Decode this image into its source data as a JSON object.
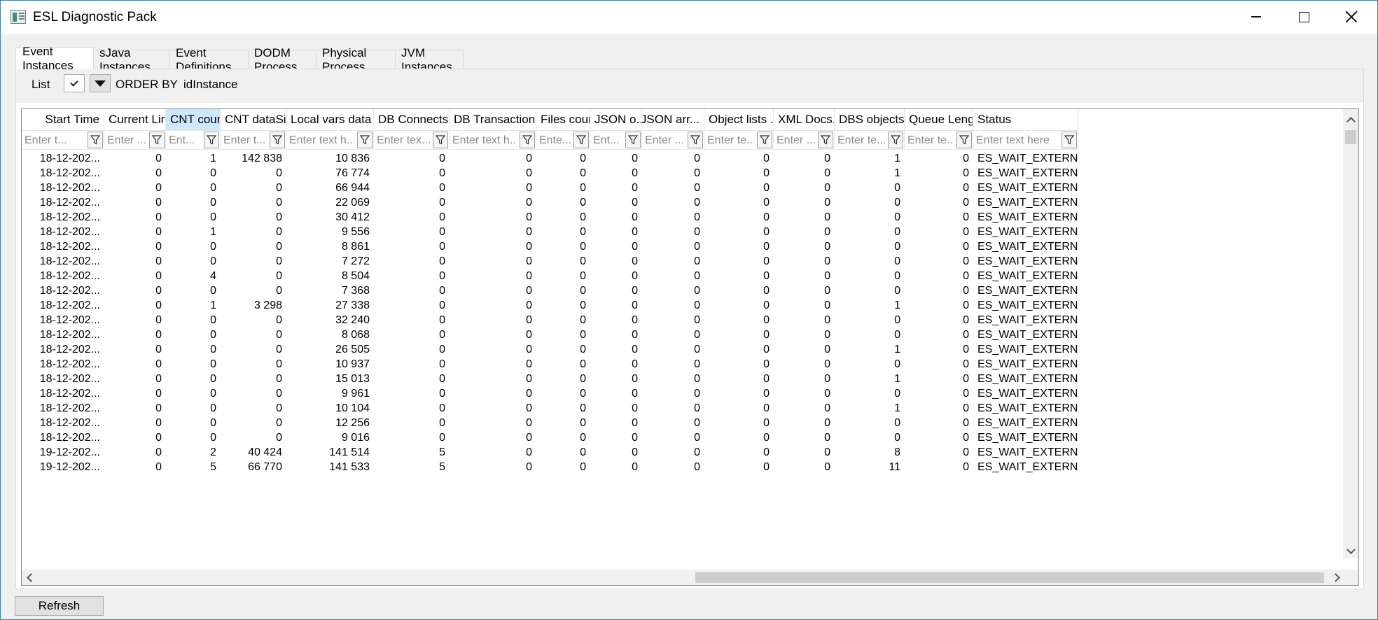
{
  "window": {
    "title": "ESL Diagnostic Pack"
  },
  "tabs": [
    {
      "label": "Event Instances",
      "active": true
    },
    {
      "label": "sJava Instances"
    },
    {
      "label": "Event Definitions"
    },
    {
      "label": "DODM Process"
    },
    {
      "label": "Physical Process"
    },
    {
      "label": "JVM Instances"
    }
  ],
  "toolbar": {
    "list_label": "List",
    "order_by_label": "ORDER BY",
    "order_by_value": "idInstance"
  },
  "columns": [
    {
      "header": "Start Time",
      "placeholder": "Enter t...",
      "align": "right"
    },
    {
      "header": "Current Line",
      "placeholder": "Enter ...",
      "align": "left"
    },
    {
      "header": "CNT count",
      "placeholder": "Ent...",
      "align": "left",
      "selected": true
    },
    {
      "header": "CNT dataSize",
      "placeholder": "Enter t...",
      "align": "left"
    },
    {
      "header": "Local vars data ...",
      "placeholder": "Enter text h...",
      "align": "left"
    },
    {
      "header": "DB Connects...",
      "placeholder": "Enter tex...",
      "align": "left"
    },
    {
      "header": "DB Transactions...",
      "placeholder": "Enter text h...",
      "align": "left"
    },
    {
      "header": "Files count",
      "placeholder": "Ente...",
      "align": "left"
    },
    {
      "header": "JSON o...",
      "placeholder": "Ent...",
      "align": "left"
    },
    {
      "header": "JSON arr...",
      "placeholder": "Enter ...",
      "align": "right"
    },
    {
      "header": "Object lists ...",
      "placeholder": "Enter te...",
      "align": "left"
    },
    {
      "header": "XML Docs...",
      "placeholder": "Enter ...",
      "align": "left"
    },
    {
      "header": "DBS objects...",
      "placeholder": "Enter te...",
      "align": "left"
    },
    {
      "header": "Queue Length",
      "placeholder": "Enter te...",
      "align": "left"
    },
    {
      "header": "Status",
      "placeholder": "Enter text here",
      "align": "left"
    }
  ],
  "rows": [
    [
      "18-12-202...",
      "0",
      "1",
      "142 838",
      "10 836",
      "0",
      "0",
      "0",
      "0",
      "0",
      "0",
      "0",
      "1",
      "0",
      "ES_WAIT_EXTERNAL_RQ"
    ],
    [
      "18-12-202...",
      "0",
      "0",
      "0",
      "76 774",
      "0",
      "0",
      "0",
      "0",
      "0",
      "0",
      "0",
      "1",
      "0",
      "ES_WAIT_EXTERNAL_RQ"
    ],
    [
      "18-12-202...",
      "0",
      "0",
      "0",
      "66 944",
      "0",
      "0",
      "0",
      "0",
      "0",
      "0",
      "0",
      "0",
      "0",
      "ES_WAIT_EXTERNAL_RQ"
    ],
    [
      "18-12-202...",
      "0",
      "0",
      "0",
      "22 069",
      "0",
      "0",
      "0",
      "0",
      "0",
      "0",
      "0",
      "0",
      "0",
      "ES_WAIT_EXTERNAL_RQ"
    ],
    [
      "18-12-202...",
      "0",
      "0",
      "0",
      "30 412",
      "0",
      "0",
      "0",
      "0",
      "0",
      "0",
      "0",
      "0",
      "0",
      "ES_WAIT_EXTERNAL_RQ"
    ],
    [
      "18-12-202...",
      "0",
      "1",
      "0",
      "9 556",
      "0",
      "0",
      "0",
      "0",
      "0",
      "0",
      "0",
      "0",
      "0",
      "ES_WAIT_EXTERNAL_RQ"
    ],
    [
      "18-12-202...",
      "0",
      "0",
      "0",
      "8 861",
      "0",
      "0",
      "0",
      "0",
      "0",
      "0",
      "0",
      "0",
      "0",
      "ES_WAIT_EXTERNAL_RQ"
    ],
    [
      "18-12-202...",
      "0",
      "0",
      "0",
      "7 272",
      "0",
      "0",
      "0",
      "0",
      "0",
      "0",
      "0",
      "0",
      "0",
      "ES_WAIT_EXTERNAL_RQ"
    ],
    [
      "18-12-202...",
      "0",
      "4",
      "0",
      "8 504",
      "0",
      "0",
      "0",
      "0",
      "0",
      "0",
      "0",
      "0",
      "0",
      "ES_WAIT_EXTERNAL_RQ"
    ],
    [
      "18-12-202...",
      "0",
      "0",
      "0",
      "7 368",
      "0",
      "0",
      "0",
      "0",
      "0",
      "0",
      "0",
      "0",
      "0",
      "ES_WAIT_EXTERNAL_RQ"
    ],
    [
      "18-12-202...",
      "0",
      "1",
      "3 298",
      "27 338",
      "0",
      "0",
      "0",
      "0",
      "0",
      "0",
      "0",
      "1",
      "0",
      "ES_WAIT_EXTERNAL_RQ"
    ],
    [
      "18-12-202...",
      "0",
      "0",
      "0",
      "32 240",
      "0",
      "0",
      "0",
      "0",
      "0",
      "0",
      "0",
      "0",
      "0",
      "ES_WAIT_EXTERNAL_RQ"
    ],
    [
      "18-12-202...",
      "0",
      "0",
      "0",
      "8 068",
      "0",
      "0",
      "0",
      "0",
      "0",
      "0",
      "0",
      "0",
      "0",
      "ES_WAIT_EXTERNAL_RQ"
    ],
    [
      "18-12-202...",
      "0",
      "0",
      "0",
      "26 505",
      "0",
      "0",
      "0",
      "0",
      "0",
      "0",
      "0",
      "1",
      "0",
      "ES_WAIT_EXTERNAL_RQ"
    ],
    [
      "18-12-202...",
      "0",
      "0",
      "0",
      "10 937",
      "0",
      "0",
      "0",
      "0",
      "0",
      "0",
      "0",
      "0",
      "0",
      "ES_WAIT_EXTERNAL_RQ"
    ],
    [
      "18-12-202...",
      "0",
      "0",
      "0",
      "15 013",
      "0",
      "0",
      "0",
      "0",
      "0",
      "0",
      "0",
      "1",
      "0",
      "ES_WAIT_EXTERNAL_RQ"
    ],
    [
      "18-12-202...",
      "0",
      "0",
      "0",
      "9 961",
      "0",
      "0",
      "0",
      "0",
      "0",
      "0",
      "0",
      "0",
      "0",
      "ES_WAIT_EXTERNAL_RQ"
    ],
    [
      "18-12-202...",
      "0",
      "0",
      "0",
      "10 104",
      "0",
      "0",
      "0",
      "0",
      "0",
      "0",
      "0",
      "1",
      "0",
      "ES_WAIT_EXTERNAL_RQ"
    ],
    [
      "18-12-202...",
      "0",
      "0",
      "0",
      "12 256",
      "0",
      "0",
      "0",
      "0",
      "0",
      "0",
      "0",
      "0",
      "0",
      "ES_WAIT_EXTERNAL_RQ"
    ],
    [
      "18-12-202...",
      "0",
      "0",
      "0",
      "9 016",
      "0",
      "0",
      "0",
      "0",
      "0",
      "0",
      "0",
      "0",
      "0",
      "ES_WAIT_EXTERNAL_RQ"
    ],
    [
      "19-12-202...",
      "0",
      "2",
      "40 424",
      "141 514",
      "5",
      "0",
      "0",
      "0",
      "0",
      "0",
      "0",
      "8",
      "0",
      "ES_WAIT_EXTERNAL_RQ"
    ],
    [
      "19-12-202...",
      "0",
      "5",
      "66 770",
      "141 533",
      "5",
      "0",
      "0",
      "0",
      "0",
      "0",
      "0",
      "11",
      "0",
      "ES_WAIT_EXTERNAL_RQ"
    ]
  ],
  "footer": {
    "refresh_label": "Refresh"
  },
  "colors": {
    "selected_header": "#cce8ff",
    "window_border": "#3c7fb1"
  }
}
